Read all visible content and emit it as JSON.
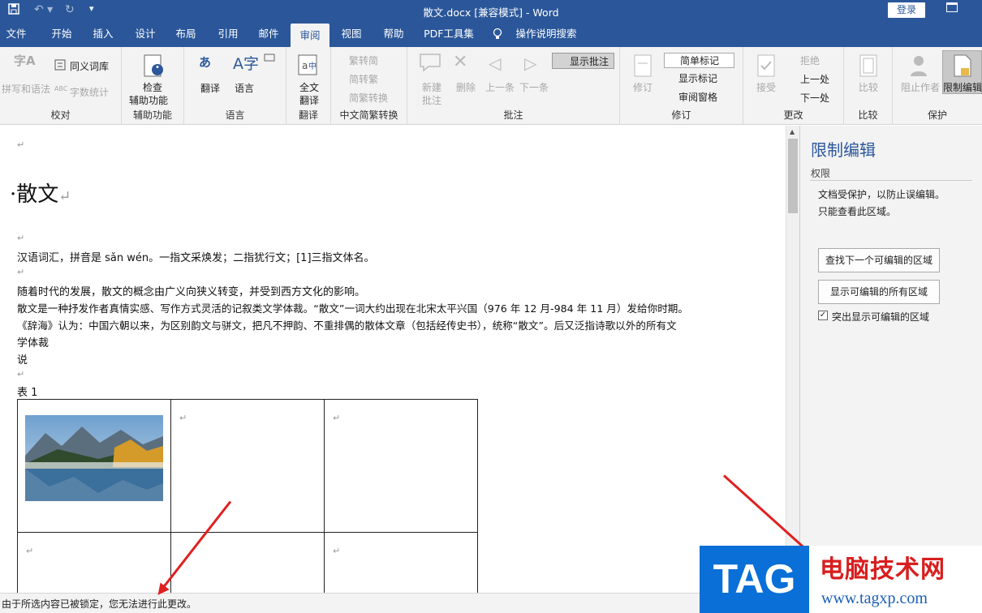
{
  "window": {
    "title": "散文.docx [兼容模式]  -  Word",
    "login": "登录"
  },
  "tabs": [
    "文件",
    "开始",
    "插入",
    "设计",
    "布局",
    "引用",
    "邮件",
    "审阅",
    "视图",
    "帮助",
    "PDF工具集",
    "操作说明搜索"
  ],
  "ribbon": {
    "proofing": {
      "spelling": "拼写和语法",
      "thesaurus": "同义词库",
      "wordcount": "字数统计",
      "label": "校对"
    },
    "accessibility": {
      "check": "检查",
      "check2": "辅助功能",
      "label": "辅助功能"
    },
    "language": {
      "translate": "翻译",
      "language": "语言",
      "label": "语言"
    },
    "translate": {
      "full1": "全文",
      "full2": "翻译",
      "label": "翻译"
    },
    "chinese": {
      "t2s": "繁转简",
      "s2t": "简转繁",
      "convert": "简繁转换",
      "label": "中文简繁转换"
    },
    "comments": {
      "new1": "新建",
      "new2": "批注",
      "delete": "删除",
      "prev": "上一条",
      "next": "下一条",
      "show": "显示批注",
      "label": "批注"
    },
    "tracking": {
      "track": "修订",
      "markup": "简单标记",
      "showmarkup": "显示标记",
      "pane": "审阅窗格",
      "label": "修订"
    },
    "changes": {
      "accept": "接受",
      "reject": "拒绝",
      "prev": "上一处",
      "next": "下一处",
      "label": "更改"
    },
    "compare": {
      "compare": "比较",
      "label": "比较"
    },
    "protect": {
      "block": "阻止作者",
      "restrict": "限制编辑",
      "label": "保护"
    }
  },
  "document": {
    "title": "散文",
    "p1": "汉语词汇，拼音是 sǎn wén。一指文采焕发；二指犹行文；[1]三指文体名。",
    "p2": "随着时代的发展，散文的概念由广义向狭义转变，并受到西方文化的影响。",
    "p3": "散文是一种抒发作者真情实感、写作方式灵活的记叙类文学体裁。“散文”一词大约出现在北宋太平兴国（976 年 12 月-984 年 11 月）发给你时期。",
    "p4": "《辞海》认为：中国六朝以来，为区别韵文与骈文，把凡不押韵、不重排偶的散体文章（包括经传史书），统称“散文”。后又泛指诗歌以外的所有文",
    "p5": "学体裁",
    "p6": "说",
    "caption": "表  1",
    "mark": "↵"
  },
  "pane": {
    "title": "限制编辑",
    "section": "权限",
    "msg1": "文档受保护，以防止误编辑。",
    "msg2": "只能查看此区域。",
    "btn_next": "查找下一个可编辑的区域",
    "btn_all": "显示可编辑的所有区域",
    "highlight": "突出显示可编辑的区域"
  },
  "status": "由于所选内容已被锁定，您无法进行此更改。",
  "watermark": {
    "tag": "TAG",
    "cn": "电脑技术网",
    "url": "www.tagxp.com"
  },
  "colors": {
    "accent": "#2b579a",
    "arrow": "#e02020"
  }
}
